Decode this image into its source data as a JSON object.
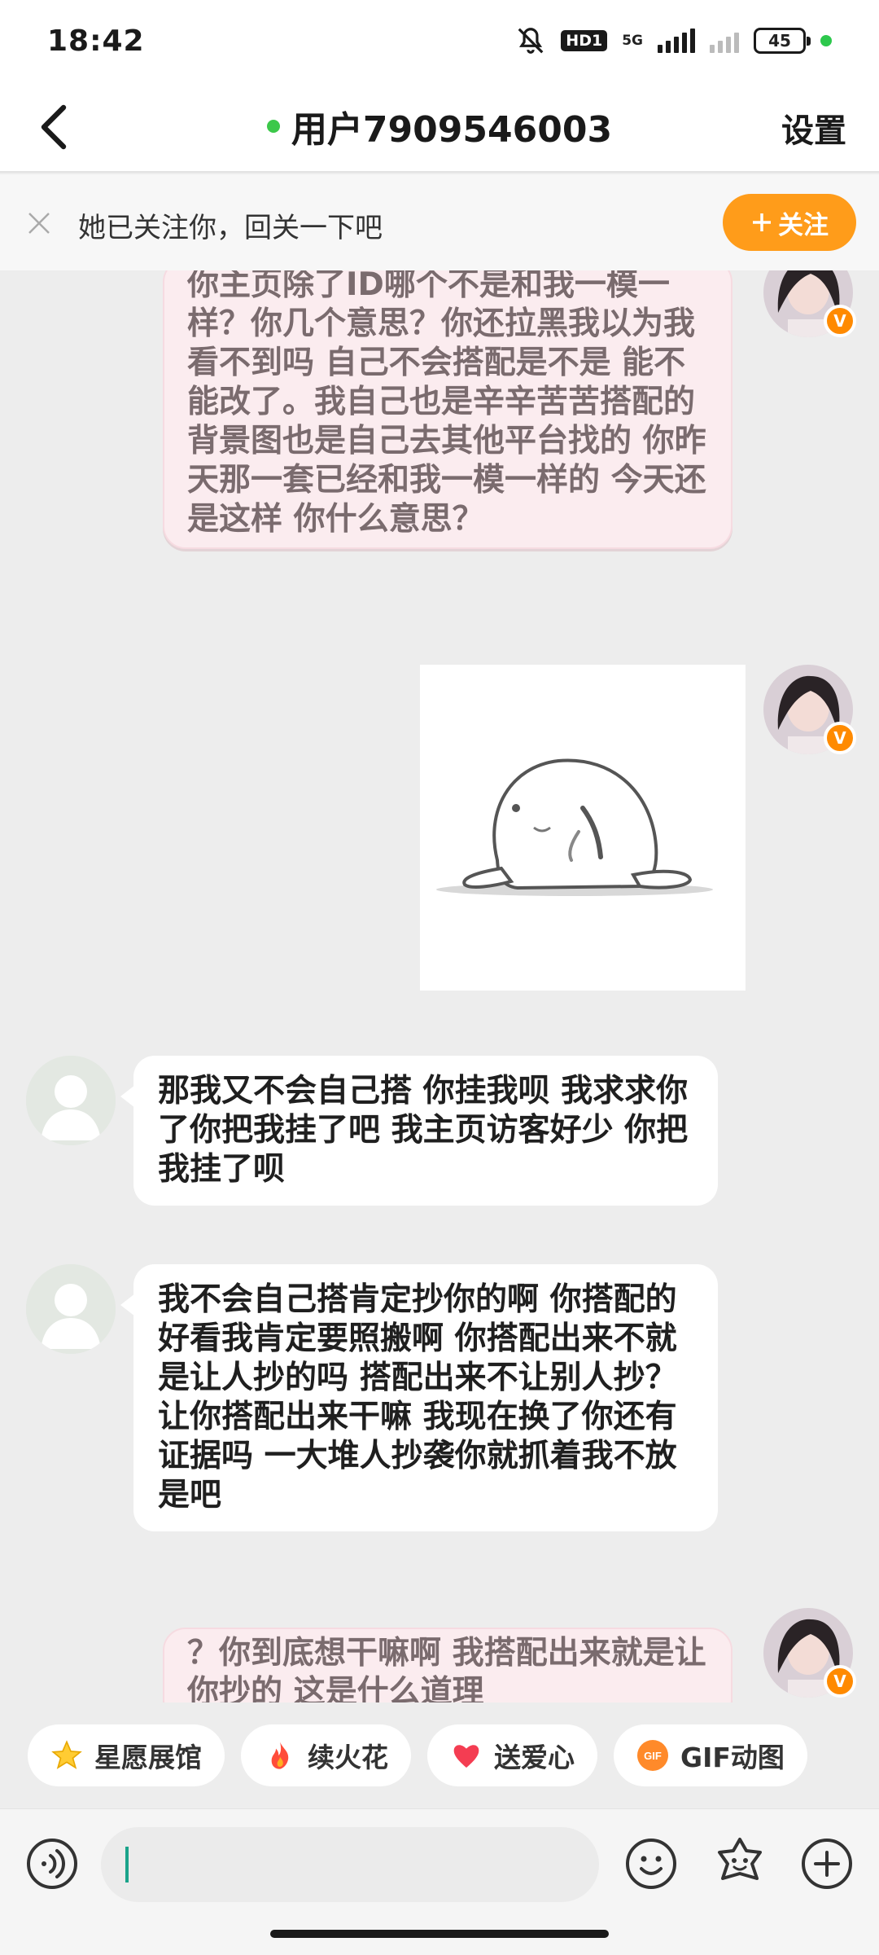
{
  "status_bar": {
    "time": "18:42",
    "hd_label": "HD1",
    "network_label": "5G",
    "battery": "45"
  },
  "header": {
    "title": "用户7909546003",
    "settings_label": "设置"
  },
  "follow_banner": {
    "text": "她已关注你，回关一下吧",
    "button_label": "关注"
  },
  "messages": [
    {
      "from": "me",
      "style": "pink-bubble",
      "text": "你主页除了ID哪个不是和我一模一样？你几个意思？你还拉黑我以为我看不到吗 自己不会搭配是不是 能不能改了。我自己也是辛辛苦苦搭配的 背景图也是自己去其他平台找的 你昨天那一套已经和我一模一样的 今天还是这样 你什么意思？"
    },
    {
      "from": "me",
      "style": "sticker",
      "sticker": "white-seal-lying-down"
    },
    {
      "from": "other",
      "style": "white-bubble",
      "text": "那我又不会自己搭 你挂我呗 我求求你了你把我挂了吧 我主页访客好少 你把我挂了呗"
    },
    {
      "from": "other",
      "style": "white-bubble",
      "text": "我不会自己搭肯定抄你的啊 你搭配的好看我肯定要照搬啊 你搭配出来不就是让人抄的吗 搭配出来不让别人抄？让你搭配出来干嘛 我现在换了你还有证据吗 一大堆人抄袭你就抓着我不放是吧"
    },
    {
      "from": "me",
      "style": "pink-bubble",
      "text": "？你到底想干嘛啊 我搭配出来就是让你抄的 这是什么道理"
    }
  ],
  "badge_label": "V",
  "quick_actions": [
    {
      "label": "星愿展馆",
      "icon": "star-icon"
    },
    {
      "label": "续火花",
      "icon": "fire-icon"
    },
    {
      "label": "送爱心",
      "icon": "heart-icon"
    },
    {
      "label": "GIF动图",
      "icon": "gif-icon",
      "icon_text": "GIF"
    }
  ],
  "input": {
    "value": ""
  },
  "colors": {
    "accent_orange": "#ff9c1a",
    "online_green": "#3cc84a",
    "pink_bubble": "#fbecef",
    "chat_background": "#ededed"
  }
}
